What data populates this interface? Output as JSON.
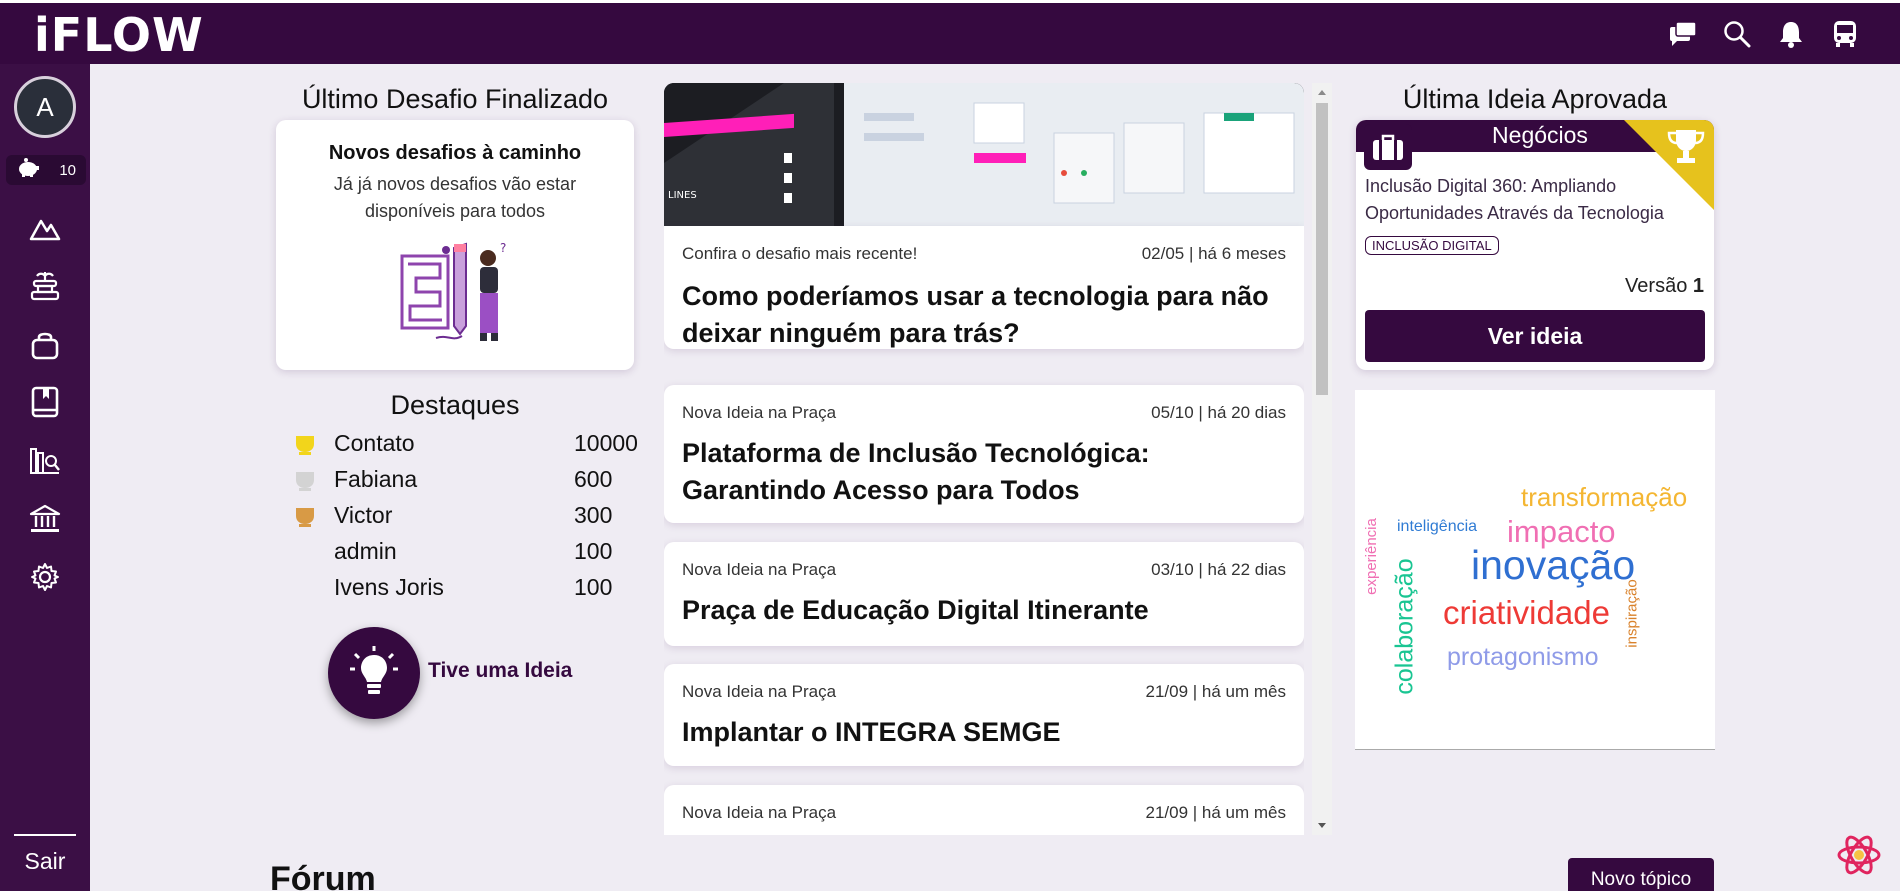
{
  "header": {
    "logo": "iFLOW",
    "icons": [
      "chat-icon",
      "search-icon",
      "bell-icon",
      "bus-icon"
    ]
  },
  "sidebar": {
    "avatar_initial": "A",
    "coins": "10",
    "items": [
      "mountain-icon",
      "fountain-icon",
      "bag-icon",
      "book-icon",
      "library-icon",
      "bank-icon",
      "gear-icon"
    ],
    "exit_label": "Sair"
  },
  "last_challenge": {
    "heading": "Último Desafio Finalizado",
    "title": "Novos desafios à caminho",
    "text": "Já já novos desafios vão estar disponíveis para todos"
  },
  "highlights": {
    "heading": "Destaques",
    "rows": [
      {
        "medal": "gold",
        "name": "Contato",
        "score": "10000"
      },
      {
        "medal": "silver",
        "name": "Fabiana",
        "score": "600"
      },
      {
        "medal": "bronze",
        "name": "Victor",
        "score": "300"
      },
      {
        "medal": "",
        "name": "admin",
        "score": "100"
      },
      {
        "medal": "",
        "name": "Ivens Joris",
        "score": "100"
      }
    ]
  },
  "idea_button": {
    "label": "Tive uma Ideia"
  },
  "feed": [
    {
      "meta": "Confira o desafio mais recente!",
      "date": "02/05 | há 6 meses",
      "title": "Como poderíamos usar a tecnologia para não deixar ninguém para trás?"
    },
    {
      "meta": "Nova Ideia na Praça",
      "date": "05/10 | há 20 dias",
      "title": "Plataforma de Inclusão Tecnológica: Garantindo Acesso para Todos"
    },
    {
      "meta": "Nova Ideia na Praça",
      "date": "03/10 | há 22 dias",
      "title": "Praça de Educação Digital Itinerante"
    },
    {
      "meta": "Nova Ideia na Praça",
      "date": "21/09 | há um mês",
      "title": "Implantar o INTEGRA SEMGE"
    },
    {
      "meta": "Nova Ideia na Praça",
      "date": "21/09 | há um mês",
      "title": ""
    }
  ],
  "approved": {
    "heading": "Última Ideia Aprovada",
    "category": "Negócios",
    "description": "Inclusão Digital 360: Ampliando Oportunidades Através da Tecnologia",
    "tag": "INCLUSÃO DIGITAL",
    "version_label": "Versão",
    "version_value": "1",
    "button": "Ver ideia"
  },
  "word_cloud": {
    "words": [
      "transformação",
      "impacto",
      "inteligência",
      "experiência",
      "inovação",
      "colaboração",
      "criatividade",
      "inspiração",
      "protagonismo"
    ]
  },
  "forum": {
    "heading": "Fórum",
    "new_topic": "Novo tópico"
  }
}
